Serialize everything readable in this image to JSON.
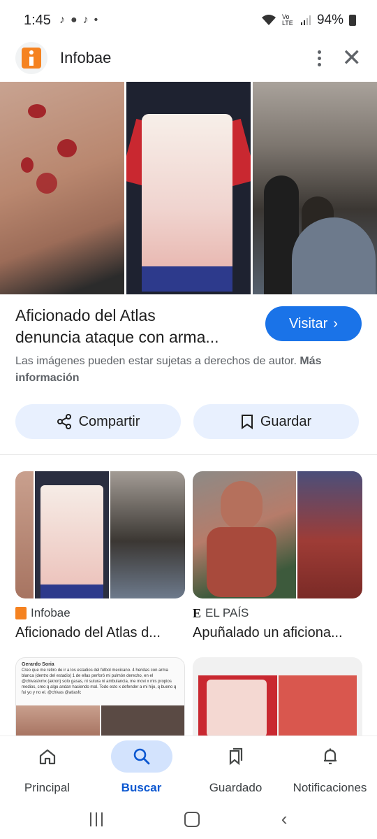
{
  "status_bar": {
    "time": "1:45",
    "battery": "94%",
    "network": "Vo LTE"
  },
  "header": {
    "site_name": "Infobae"
  },
  "article": {
    "title_line1": "Aficionado del Atlas",
    "title_line2": "denuncia ataque con arma...",
    "visit_label": "Visitar",
    "copyright_text": "Las imágenes pueden estar sujetas a derechos de autor.",
    "more_info": "Más información"
  },
  "actions": {
    "share_label": "Compartir",
    "save_label": "Guardar"
  },
  "results": [
    {
      "source": "Infobae",
      "title": "Aficionado del Atlas d..."
    },
    {
      "source": "EL PAÍS",
      "source_mark": "E",
      "title": "Apuñalado un aficiona..."
    }
  ],
  "tweet_preview": {
    "author": "Gerardo Soria",
    "text": "Creo que me retiro de ir a los estadios del fútbol mexicano. 4 heridas con arma blanca (dentro del estadio) 1 de ellas perforó mi pulmón derecho, en el @chivastvmx (akron) solo gasas, ni sutura ni ambulancia, me movi x mis propios medios, creo q algo andan haciendo mal. Todo esto x defender a mi hijo, q bueno q fui yo y no el. @chivas @atlasfc"
  },
  "bottom_nav": [
    {
      "label": "Principal",
      "icon": "home-icon"
    },
    {
      "label": "Buscar",
      "icon": "search-icon"
    },
    {
      "label": "Guardado",
      "icon": "bookmarks-icon"
    },
    {
      "label": "Notificaciones",
      "icon": "bell-icon"
    }
  ],
  "colors": {
    "accent": "#1a73e8",
    "chip": "#e8f0fe",
    "nav_active": "#d3e3fd",
    "infobae": "#f58220"
  }
}
